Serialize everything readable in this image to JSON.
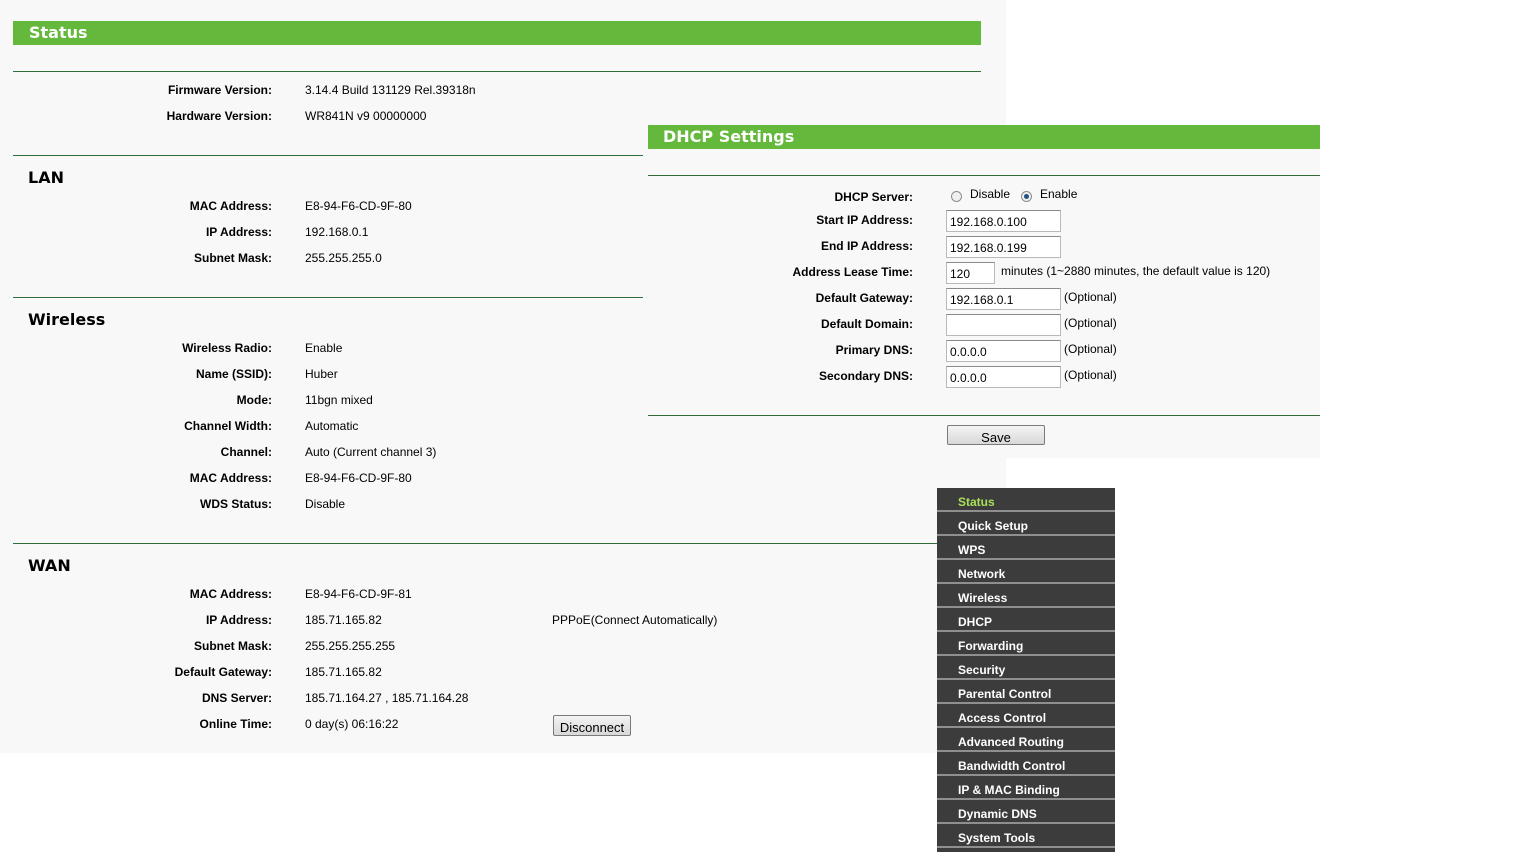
{
  "status": {
    "title": "Status",
    "firmware": {
      "label": "Firmware Version:",
      "value": "3.14.4 Build 131129 Rel.39318n"
    },
    "hardware": {
      "label": "Hardware Version:",
      "value": "WR841N v9 00000000"
    },
    "lan": {
      "title": "LAN",
      "rows": [
        {
          "label": "MAC Address:",
          "value": "E8-94-F6-CD-9F-80"
        },
        {
          "label": "IP Address:",
          "value": "192.168.0.1"
        },
        {
          "label": "Subnet Mask:",
          "value": "255.255.255.0"
        }
      ]
    },
    "wireless": {
      "title": "Wireless",
      "rows": [
        {
          "label": "Wireless Radio:",
          "value": "Enable"
        },
        {
          "label": "Name (SSID):",
          "value": "Huber"
        },
        {
          "label": "Mode:",
          "value": "11bgn mixed"
        },
        {
          "label": "Channel Width:",
          "value": "Automatic"
        },
        {
          "label": "Channel:",
          "value": "Auto (Current channel 3)"
        },
        {
          "label": "MAC Address:",
          "value": "E8-94-F6-CD-9F-80"
        },
        {
          "label": "WDS Status:",
          "value": "Disable"
        }
      ]
    },
    "wan": {
      "title": "WAN",
      "rows": [
        {
          "label": "MAC Address:",
          "value": "E8-94-F6-CD-9F-81"
        },
        {
          "label": "IP Address:",
          "value": "185.71.165.82",
          "extra": "PPPoE(Connect Automatically)"
        },
        {
          "label": "Subnet Mask:",
          "value": "255.255.255.255"
        },
        {
          "label": "Default Gateway:",
          "value": "185.71.165.82"
        },
        {
          "label": "DNS Server:",
          "value": "185.71.164.27 , 185.71.164.28"
        },
        {
          "label": "Online Time:",
          "value": "0 day(s) 06:16:22"
        }
      ],
      "disconnect_label": "Disconnect"
    }
  },
  "dhcp": {
    "title": "DHCP Settings",
    "server": {
      "label": "DHCP Server:",
      "disable": "Disable",
      "enable": "Enable",
      "selected": "Enable"
    },
    "start_ip": {
      "label": "Start IP Address:",
      "value": "192.168.0.100"
    },
    "end_ip": {
      "label": "End IP Address:",
      "value": "192.168.0.199"
    },
    "lease": {
      "label": "Address Lease Time:",
      "value": "120",
      "note": "minutes (1~2880 minutes, the default value is 120)"
    },
    "gateway": {
      "label": "Default Gateway:",
      "value": "192.168.0.1",
      "note": "(Optional)"
    },
    "domain": {
      "label": "Default Domain:",
      "value": "",
      "note": "(Optional)"
    },
    "primary_dns": {
      "label": "Primary DNS:",
      "value": "0.0.0.0",
      "note": "(Optional)"
    },
    "secondary_dns": {
      "label": "Secondary DNS:",
      "value": "0.0.0.0",
      "note": "(Optional)"
    },
    "save_label": "Save"
  },
  "menu": {
    "active": "Status",
    "items": [
      "Status",
      "Quick Setup",
      "WPS",
      "Network",
      "Wireless",
      "DHCP",
      "Forwarding",
      "Security",
      "Parental Control",
      "Access Control",
      "Advanced Routing",
      "Bandwidth Control",
      "IP & MAC Binding",
      "Dynamic DNS",
      "System Tools"
    ]
  },
  "colors": {
    "accent": "#64b83c",
    "menu_bg": "#3c3c3c",
    "menu_active": "#a8e05a",
    "rule": "#316b3b"
  }
}
